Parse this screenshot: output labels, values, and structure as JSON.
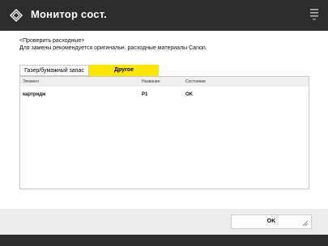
{
  "window": {
    "title": "Монитор сост."
  },
  "header": {
    "line1": "<Проверить расходные>",
    "line2": "Для замены рекомендуется оригинальн. расходные материалы Canon."
  },
  "tabs": [
    {
      "label": "Газер/бумажный запас",
      "active": false
    },
    {
      "label": "Другое",
      "active": true
    }
  ],
  "table": {
    "columns": [
      "Элемент",
      "Название",
      "Состояние"
    ],
    "rows": [
      {
        "item": "картридж",
        "name": "P1",
        "status": "OK"
      }
    ]
  },
  "footer": {
    "ok_label": "OK"
  },
  "colors": {
    "titlebar": "#2d2d2d",
    "active_tab": "#ffe600",
    "background": "#ececec"
  },
  "icons": {
    "app": "status-monitor-icon",
    "menu": "menu-icon",
    "resize": "resize-grip-icon"
  }
}
